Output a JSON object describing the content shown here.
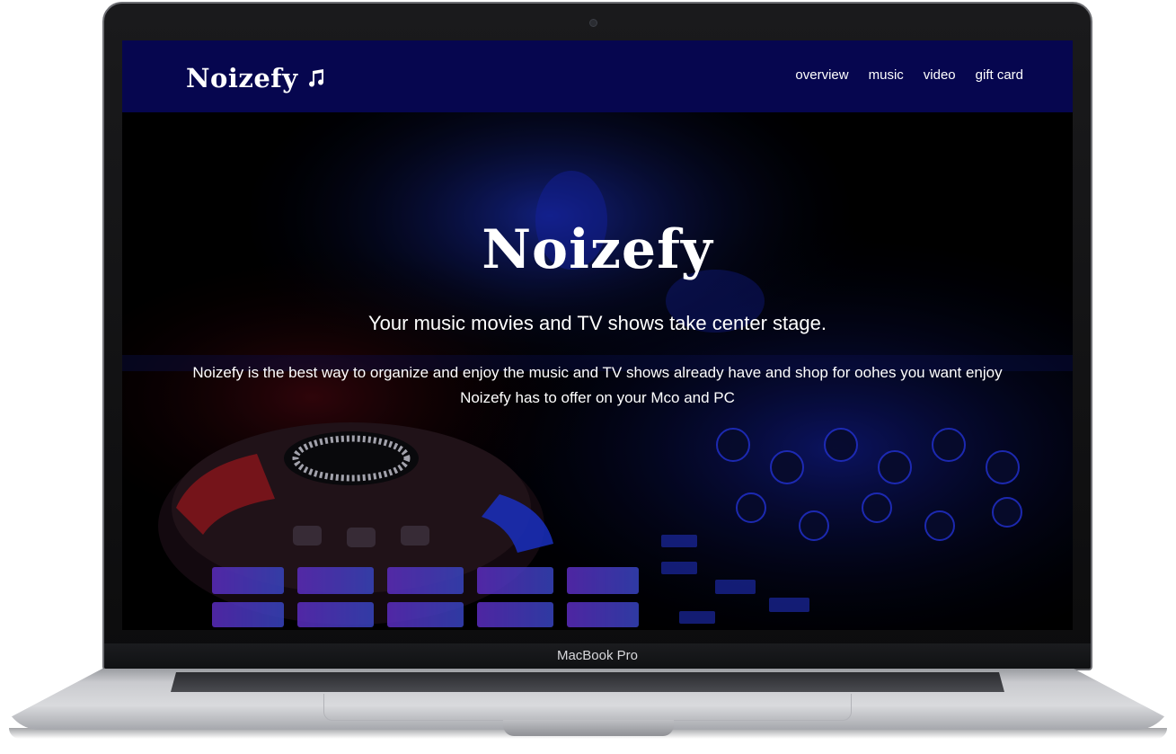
{
  "site": {
    "brand": "Noizefy",
    "brand_icon": "music-note-icon",
    "nav": [
      {
        "label": "overview"
      },
      {
        "label": "music"
      },
      {
        "label": "video"
      },
      {
        "label": "gift card"
      }
    ],
    "hero": {
      "title": "Noizefy",
      "subtitle": "Your music movies and TV shows take center stage.",
      "body_line1": "Noizefy is the best way to organize and enjoy the music and TV shows already have and shop for oohes you want enjoy",
      "body_line2": "Noizefy has to offer on your Mco and PC"
    },
    "colors": {
      "navbar": "#06064f",
      "text": "#ffffff",
      "background": "#000000"
    }
  },
  "device": {
    "model_label": "MacBook Pro"
  }
}
